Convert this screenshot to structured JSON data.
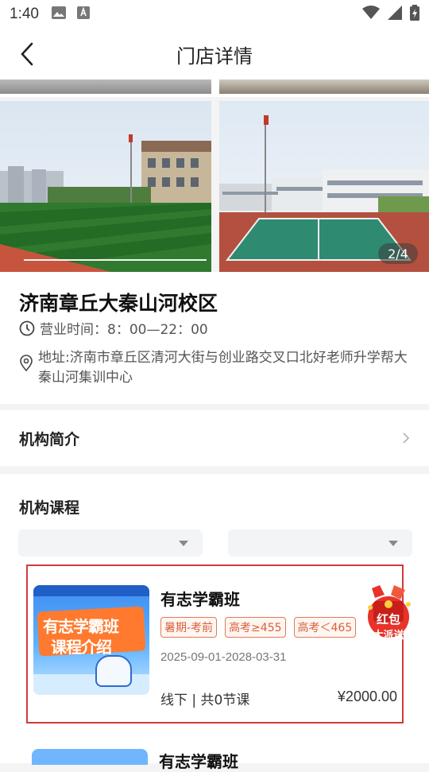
{
  "status": {
    "time": "1:40"
  },
  "nav": {
    "title": "门店详情"
  },
  "gallery": {
    "counter": "2/4"
  },
  "store": {
    "name": "济南章丘大秦山河校区",
    "hours": "营业时间：8：00—22：00",
    "address": "地址:济南市章丘区清河大街与创业路交叉口北好老师升学帮大秦山河集训中心"
  },
  "intro": {
    "label": "机构简介"
  },
  "courses": {
    "heading": "机构课程",
    "items": [
      {
        "name": "有志学霸班",
        "tags": [
          "暑期-考前",
          "高考≥455",
          "高考＜465"
        ],
        "date_range": "2025-09-01-2028-03-31",
        "meta": "线下 | 共0节课",
        "price": "¥2000.00",
        "thumb_line1": "有志学霸班",
        "thumb_line2": "课程介绍"
      },
      {
        "name": "有志学霸班"
      }
    ],
    "promo_line1": "红包",
    "promo_line2": "大派送"
  },
  "colors": {
    "accent_red": "#d23b3b",
    "tag_orange": "#e07a55"
  }
}
